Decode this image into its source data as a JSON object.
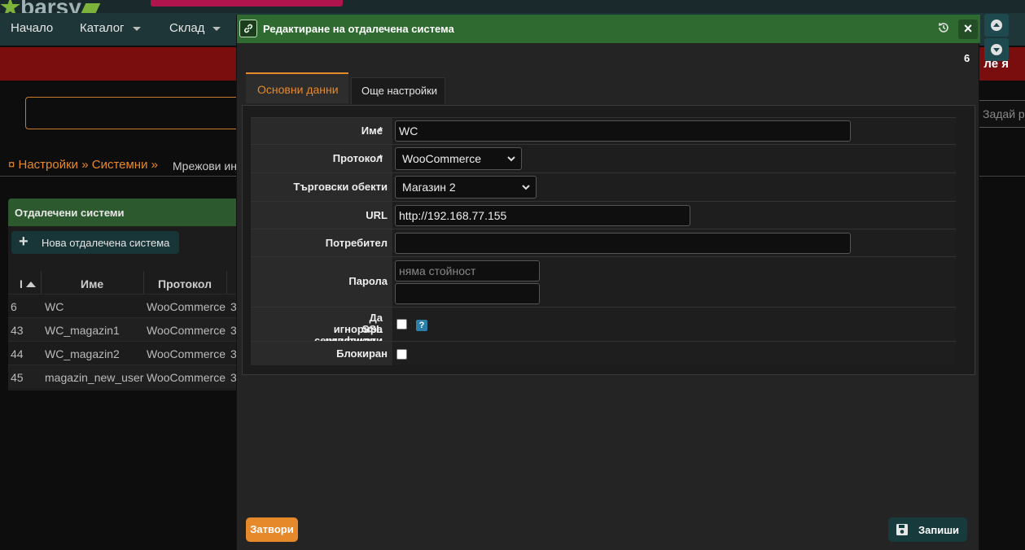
{
  "app": {
    "logo_text": "barsy",
    "nav": [
      "Начало",
      "Каталог",
      "Склад"
    ],
    "redband_text": "ле я",
    "search_right_placeholder": "Задай р",
    "breadcrumbs": "¤ Настройки » Системни »",
    "breadcrumb_sub": "Мрежови ин"
  },
  "list_panel": {
    "title": "Отдалечени системи",
    "new_button": "Нова отдалечена система",
    "columns": [
      "I",
      "Име",
      "Протокол"
    ],
    "rows": [
      {
        "id": "6",
        "name": "WC",
        "protocol": "WooCommerce",
        "extra": "3"
      },
      {
        "id": "43",
        "name": "WC_magazin1",
        "protocol": "WooCommerce",
        "extra": "3"
      },
      {
        "id": "44",
        "name": "WC_magazin2",
        "protocol": "WooCommerce",
        "extra": "3"
      },
      {
        "id": "45",
        "name": "magazin_new_user",
        "protocol": "WooCommerce",
        "extra": "3"
      }
    ]
  },
  "modal": {
    "title": "Редактиране на отдалечена система",
    "record_id": "6",
    "tabs": [
      "Основни данни",
      "Още настройки"
    ],
    "fields": {
      "name_label": "Име",
      "name_value": "WC",
      "protocol_label": "Протокол",
      "protocol_value": "WooCommerce",
      "stores_label": "Търговски обекти",
      "stores_value": "Магазин 2",
      "url_label": "URL",
      "url_value": "http://192.168.77.155",
      "user_label": "Потребител",
      "user_value": "",
      "password_label": "Парола",
      "password_placeholder": "няма стойност",
      "ssl_label_1": "Да игнорира невалидни",
      "ssl_label_2": "SSL сертификати",
      "ssl_help": "?",
      "blocked_label": "Блокиран",
      "required_mark": "*"
    },
    "close_button": "Затвори",
    "save_button": "Запиши"
  },
  "colors": {
    "modal_header": "#2f6b31",
    "accent_orange": "#e6892b",
    "nav_bg": "#1e3638",
    "red_band": "#7a0d0d"
  }
}
